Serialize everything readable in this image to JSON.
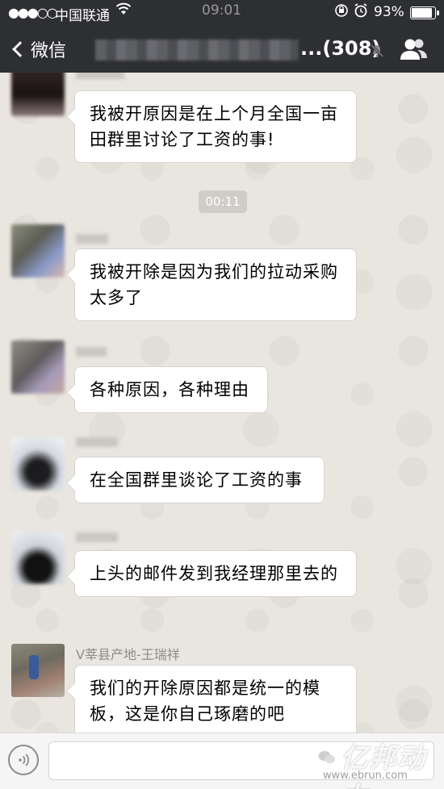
{
  "status_bar": {
    "signal_dots": "●●●○○",
    "carrier": "中国联通",
    "time": "09:01",
    "battery_percent": "93%",
    "battery_level": 0.93
  },
  "nav": {
    "back_label": "微信",
    "title_suffix": "...(308)"
  },
  "chat": {
    "timestamp": "00:11",
    "messages": [
      {
        "sender": "",
        "text": "我被开原因是在上个月全国一亩田群里讨论了工资的事!"
      },
      {
        "sender": "",
        "text": "我被开除是因为我们的拉动采购太多了"
      },
      {
        "sender": "",
        "text": "各种原因，各种理由"
      },
      {
        "sender": "",
        "text": "在全国群里谈论了工资的事"
      },
      {
        "sender": "",
        "text": "上头的邮件发到我经理那里去的"
      },
      {
        "sender": "V莘县产地-王瑞祥",
        "text": "我们的开除原因都是统一的模板，这是你自己琢磨的吧"
      }
    ]
  },
  "watermark": {
    "brand": "亿邦动力",
    "url": "www.ebrun.com"
  }
}
